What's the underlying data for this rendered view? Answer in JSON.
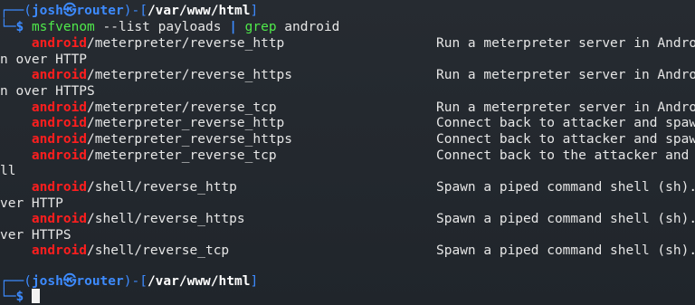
{
  "prompt1": {
    "corner_top": "┌──",
    "user_host_open": "(",
    "user": "josh",
    "at_icon": "㉿",
    "host": "router",
    "user_host_close": ")",
    "dash": "-",
    "dir_open": "[",
    "dir": "/var/www/html",
    "dir_close": "]",
    "corner_bottom": "└─",
    "dollar": "$",
    "cmd": "msfvenom",
    "args": " --list payloads ",
    "pipe": "|",
    "cmd2": " grep",
    "args2": " android"
  },
  "payloads": [
    {
      "prefix": "android",
      "rest": "/meterpreter/reverse_http",
      "desc": "Run a meterpreter server in Andro",
      "wrap": "n over HTTP"
    },
    {
      "prefix": "android",
      "rest": "/meterpreter/reverse_https",
      "desc": "Run a meterpreter server in Andro",
      "wrap": "n over HTTPS"
    },
    {
      "prefix": "android",
      "rest": "/meterpreter/reverse_tcp",
      "desc": "Run a meterpreter server in Andro",
      "wrap": ""
    },
    {
      "prefix": "android",
      "rest": "/meterpreter_reverse_http",
      "desc": "Connect back to attacker and spaw",
      "wrap": ""
    },
    {
      "prefix": "android",
      "rest": "/meterpreter_reverse_https",
      "desc": "Connect back to attacker and spaw",
      "wrap": ""
    },
    {
      "prefix": "android",
      "rest": "/meterpreter_reverse_tcp",
      "desc": "Connect back to the attacker and",
      "wrap": "ll"
    },
    {
      "prefix": "android",
      "rest": "/shell/reverse_http",
      "desc": "Spawn a piped command shell (sh).",
      "wrap": "ver HTTP"
    },
    {
      "prefix": "android",
      "rest": "/shell/reverse_https",
      "desc": "Spawn a piped command shell (sh).",
      "wrap": "ver HTTPS"
    },
    {
      "prefix": "android",
      "rest": "/shell/reverse_tcp",
      "desc": "Spawn a piped command shell (sh).",
      "wrap": ""
    }
  ],
  "prompt2": {
    "corner_top": "┌──",
    "user_host_open": "(",
    "user": "josh",
    "at_icon": "㉿",
    "host": "router",
    "user_host_close": ")",
    "dash": "-",
    "dir_open": "[",
    "dir": "/var/www/html",
    "dir_close": "]",
    "corner_bottom": "└─",
    "dollar": "$"
  }
}
